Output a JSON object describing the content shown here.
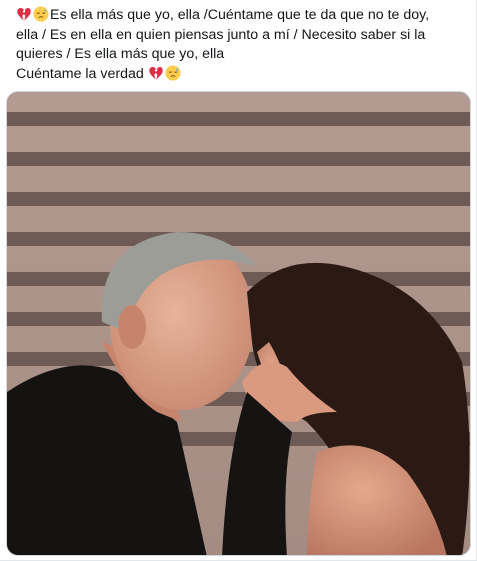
{
  "tweet": {
    "lines": [
      "Es ella más que yo, ella /Cuéntame que te da que no te doy,",
      "ella / Es en ella en quien piensas junto a mí / Necesito saber si la",
      "quieres / Es ella más que yo, ella",
      "Cuéntame la verdad"
    ],
    "leading_emojis": [
      "broken-heart-icon",
      "sad-relieved-face-icon"
    ],
    "trailing_emojis": [
      "broken-heart-icon",
      "sad-relieved-face-icon"
    ]
  },
  "media": {
    "alt": "photo",
    "colors": {
      "shutter_light": "#b59a91",
      "shutter_dark": "#6e5a54",
      "hair_woman": "#2a1a14",
      "skin": "#d79c83",
      "jacket": "#151413"
    }
  }
}
